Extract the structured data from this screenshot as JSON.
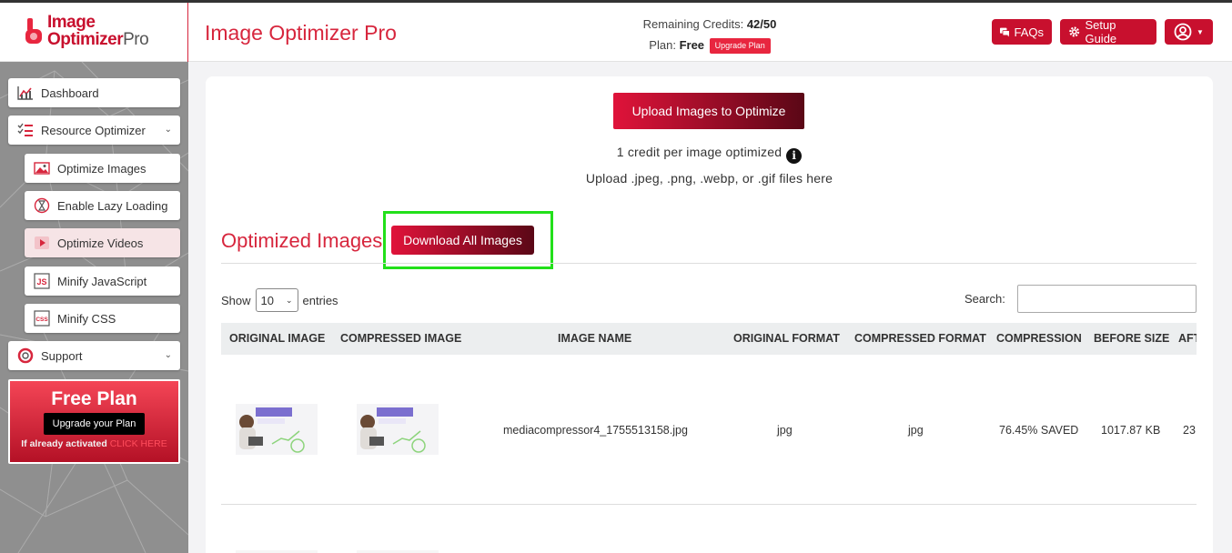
{
  "header": {
    "logo_line1": "Image",
    "logo_line2": "Optimizer",
    "logo_pro": "Pro",
    "app_title": "Image Optimizer Pro",
    "credits_label": "Remaining Credits:",
    "credits_value": "42/50",
    "plan_label": "Plan:",
    "plan_value": "Free",
    "upgrade_plan": "Upgrade Plan",
    "faqs": "FAQs",
    "setup_guide": "Setup Guide"
  },
  "sidebar": {
    "dashboard": "Dashboard",
    "resource_optimizer": "Resource Optimizer",
    "optimize_images": "Optimize Images",
    "enable_lazy_loading": "Enable Lazy Loading",
    "optimize_videos": "Optimize Videos",
    "minify_javascript": "Minify JavaScript",
    "minify_css": "Minify CSS",
    "support": "Support"
  },
  "promo": {
    "title": "Free Plan",
    "button": "Upgrade your Plan",
    "note": "If already activated",
    "click_here": "CLICK HERE"
  },
  "main": {
    "upload_button": "Upload Images to Optimize",
    "credit_note": "1 credit per image optimized",
    "upload_hint": "Upload .jpeg, .png, .webp, or .gif files here",
    "section_title": "Optimized Images",
    "download_all": "Download All Images",
    "show_label": "Show",
    "entries_value": "10",
    "entries_label": "entries",
    "search_label": "Search:"
  },
  "table": {
    "headers": {
      "original_image": "ORIGINAL IMAGE",
      "compressed_image": "COMPRESSED IMAGE",
      "image_name": "IMAGE NAME",
      "original_format": "ORIGINAL FORMAT",
      "compressed_format": "COMPRESSED FORMAT",
      "compression": "COMPRESSION",
      "before_size": "BEFORE SIZE",
      "after_size": "AFT"
    },
    "rows": [
      {
        "image_name": "mediacompressor4_1755513158.jpg",
        "original_format": "jpg",
        "compressed_format": "jpg",
        "compression": "76.45% SAVED",
        "before_size": "1017.87 KB",
        "after_size": "23"
      }
    ]
  },
  "colors": {
    "brand_red": "#c8102e",
    "highlight_green": "#22e01a"
  }
}
